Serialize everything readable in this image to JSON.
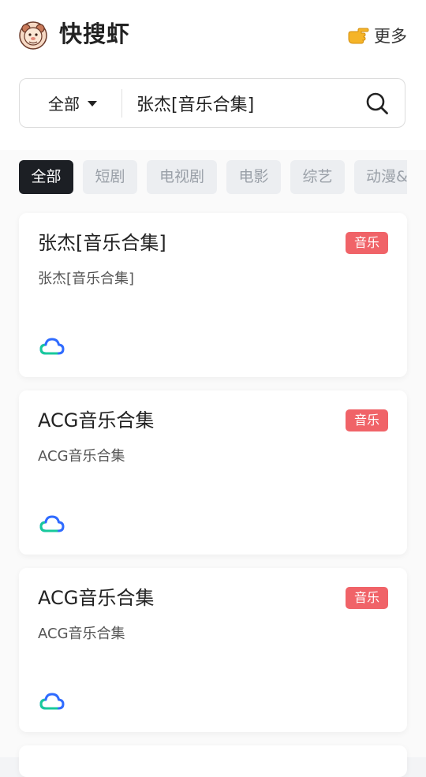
{
  "header": {
    "app_title": "快搜虾",
    "more_label": "更多"
  },
  "search": {
    "scope": "全部",
    "query": "张杰[音乐合集]"
  },
  "tabs": [
    {
      "label": "全部",
      "active": true
    },
    {
      "label": "短剧",
      "active": false
    },
    {
      "label": "电视剧",
      "active": false
    },
    {
      "label": "电影",
      "active": false
    },
    {
      "label": "综艺",
      "active": false
    },
    {
      "label": "动漫&",
      "active": false
    }
  ],
  "results": [
    {
      "title": "张杰[音乐合集]",
      "subtitle": "张杰[音乐合集]",
      "badge": "音乐",
      "source_icon": "cloud-drive-icon"
    },
    {
      "title": "ACG音乐合集",
      "subtitle": "ACG音乐合集",
      "badge": "音乐",
      "source_icon": "cloud-drive-icon"
    },
    {
      "title": "ACG音乐合集",
      "subtitle": "ACG音乐合集",
      "badge": "音乐",
      "source_icon": "cloud-drive-icon"
    }
  ],
  "colors": {
    "badge": "#f06368",
    "active_tab": "#1c1f24",
    "cloud_primary": "#2f6bff",
    "cloud_secondary": "#18c99b"
  }
}
